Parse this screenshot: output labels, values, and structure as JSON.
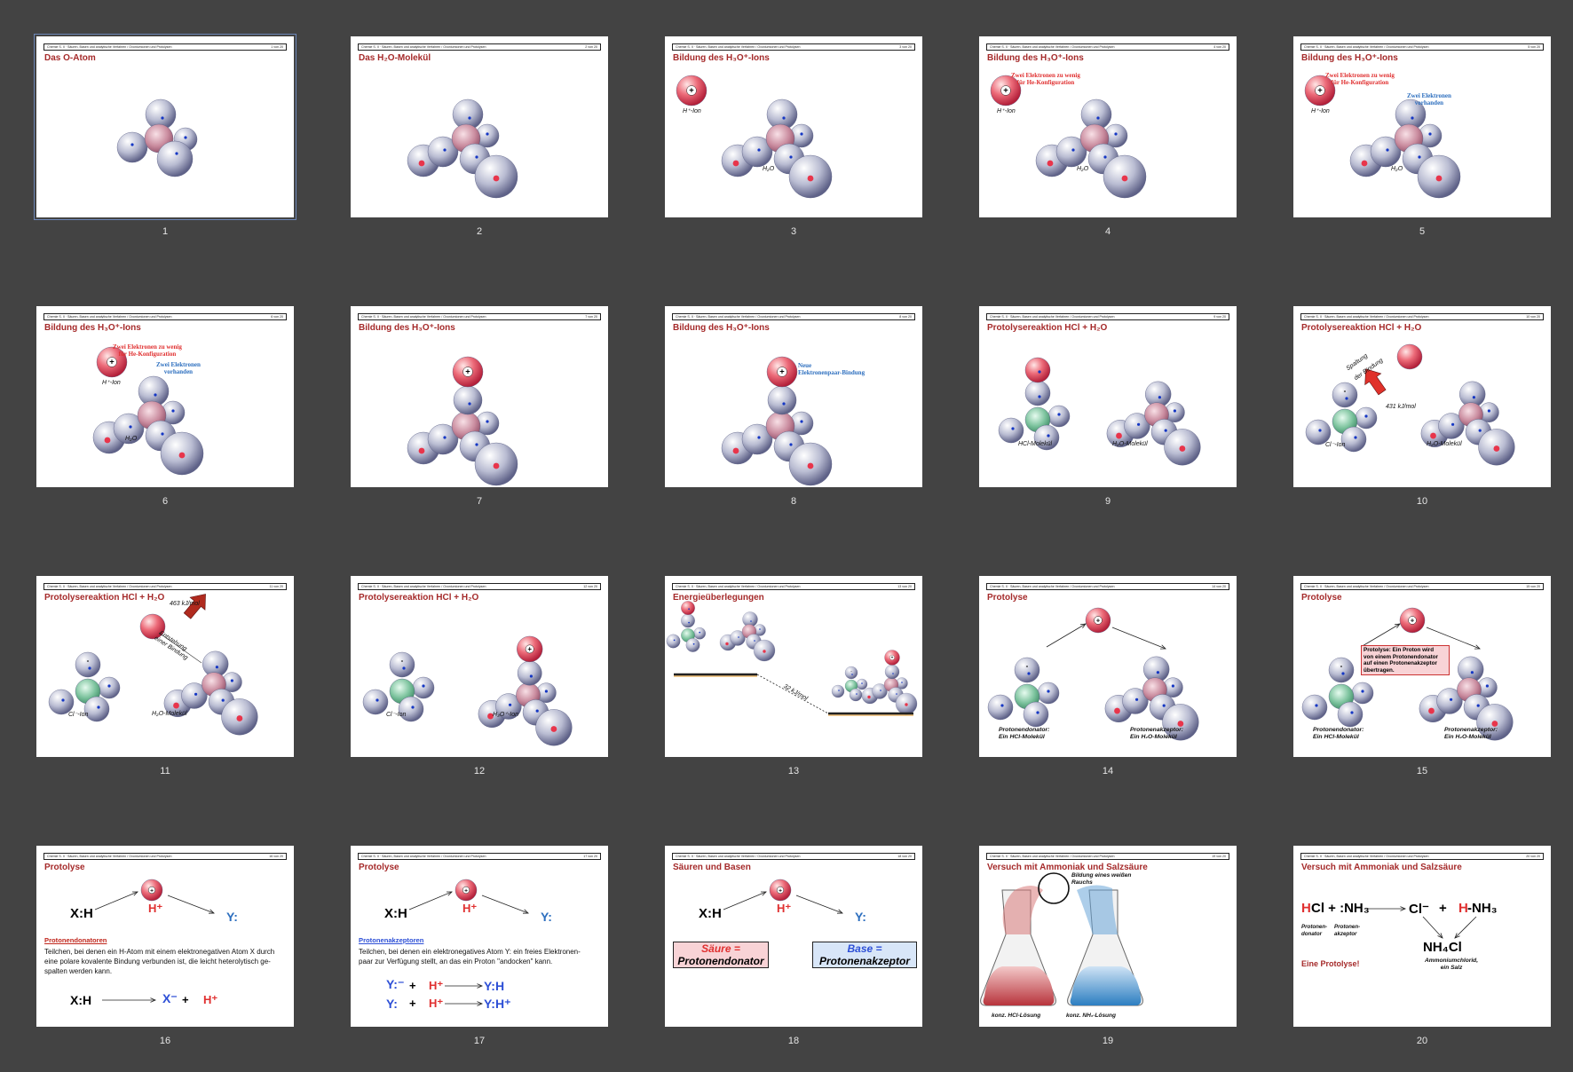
{
  "sorter": {
    "selected_slide": 1,
    "header_text": "Chemie S. II · Säuren, Basen und analytische Verfahren / Oxoniumionen und Protolysen",
    "colors": {
      "background": "#434343",
      "title": "#a52a2a",
      "red": "#e03030",
      "blue": "#2d6fbf"
    }
  },
  "slides": [
    {
      "number": "1",
      "page": "1 von 20",
      "title": "Das O-Atom"
    },
    {
      "number": "2",
      "page": "2 von 20",
      "title": "Das H₂O-Molekül"
    },
    {
      "number": "3",
      "page": "3 von 20",
      "title": "Bildung des H₃O⁺-Ions",
      "labels": [
        "H⁺-Ion",
        "H₂O"
      ]
    },
    {
      "number": "4",
      "page": "4 von 20",
      "title": "Bildung des H₃O⁺-Ions",
      "labels": [
        "Zwei Elektronen zu wenig",
        "für He-Konfiguration",
        "H⁺-Ion",
        "H₂O"
      ]
    },
    {
      "number": "5",
      "page": "5 von 20",
      "title": "Bildung des H₃O⁺-Ions",
      "labels": [
        "Zwei Elektronen zu wenig",
        "für He-Konfiguration",
        "Zwei Elektronen",
        "vorhanden",
        "H⁺-Ion",
        "H₂O"
      ]
    },
    {
      "number": "6",
      "page": "6 von 20",
      "title": "Bildung des H₃O⁺-Ions",
      "labels": [
        "Zwei Elektronen zu wenig",
        "für He-Konfiguration",
        "Zwei Elektronen",
        "vorhanden",
        "H⁺-Ion",
        "H₂O"
      ]
    },
    {
      "number": "7",
      "page": "7 von 20",
      "title": "Bildung des H₃O⁺-Ions"
    },
    {
      "number": "8",
      "page": "8 von 20",
      "title": "Bildung des H₃O⁺-Ions",
      "labels": [
        "Neue",
        "Elektronenpaar-Bindung"
      ]
    },
    {
      "number": "9",
      "page": "9 von 20",
      "title": "Protolysereaktion HCl + H₂O",
      "labels": [
        "HCl-Molekül",
        "H₂O-Molekül"
      ]
    },
    {
      "number": "10",
      "page": "10 von 20",
      "title": "Protolysereaktion HCl + H₂O",
      "labels": [
        "Spaltung",
        "der Bindung",
        "431 kJ/mol",
        "Cl⁻-Ion",
        "H₂O-Molekül"
      ]
    },
    {
      "number": "11",
      "page": "11 von 20",
      "title": "Protolysereaktion HCl + H₂O",
      "labels": [
        "463 kJ/mol",
        "Entstehung",
        "einer Bindung",
        "Cl⁻-Ion",
        "H₂O-Molekül"
      ]
    },
    {
      "number": "12",
      "page": "12 von 20",
      "title": "Protolysereaktion HCl + H₂O",
      "labels": [
        "Cl⁻-Ion",
        "H₃O⁺-Ion"
      ]
    },
    {
      "number": "13",
      "page": "13 von 20",
      "title": "Energieüberlegungen",
      "labels": [
        "32 kJ/mol"
      ]
    },
    {
      "number": "14",
      "page": "14 von 20",
      "title": "Protolyse",
      "labels": [
        "Protonendonator:",
        "Ein HCl-Molekül",
        "Protonenakzeptor:",
        "Ein H₂O-Molekül"
      ]
    },
    {
      "number": "15",
      "page": "15 von 20",
      "title": "Protolyse",
      "labels": [
        "Protolyse: Ein Proton wird",
        "von einem Protonendonator",
        "auf einen Protonenakzeptor",
        "übertragen.",
        "Protonendonator:",
        "Ein HCl-Molekül",
        "Protonenakzeptor:",
        "Ein H₂O-Molekül"
      ]
    },
    {
      "number": "16",
      "page": "16 von 20",
      "title": "Protolyse",
      "labels": [
        "X:H",
        "H⁺",
        "Y:",
        "Protonendonatoren",
        "Teilchen, bei denen ein H-Atom mit einem elektronegativen Atom X durch",
        "eine polare kovalente Bindung verbunden ist, die leicht heterolytisch ge-",
        "spalten werden kann.",
        "X:H",
        "X⁻",
        "+",
        "H⁺"
      ]
    },
    {
      "number": "17",
      "page": "17 von 20",
      "title": "Protolyse",
      "labels": [
        "X:H",
        "H⁺",
        "Y:",
        "Protonenakzeptoren",
        "Teilchen, bei denen ein elektronegatives Atom Y: ein freies Elektronen-",
        "paar zur Verfügung stellt, an das ein Proton \"andocken\" kann.",
        "Y:⁻",
        "+",
        "H⁺",
        "Y:H",
        "Y:",
        "+",
        "H⁺",
        "Y:H⁺"
      ]
    },
    {
      "number": "18",
      "page": "18 von 20",
      "title": "Säuren und Basen",
      "labels": [
        "X:H",
        "H⁺",
        "Y:",
        "Säure =",
        "Protonendonator",
        "Base =",
        "Protonenakzeptor"
      ]
    },
    {
      "number": "19",
      "page": "19 von 20",
      "title": "Versuch mit Ammoniak und Salzsäure",
      "labels": [
        "Bildung eines weißen",
        "Rauchs",
        "konz. HCl-Lösung",
        "konz. NH₃-Lösung"
      ]
    },
    {
      "number": "20",
      "page": "20 von 20",
      "title": "Versuch mit Ammoniak und Salzsäure",
      "labels": [
        "H",
        "Cl + :NH₃",
        "Cl⁻",
        "+",
        "H",
        "-NH₃",
        "Protonen-",
        "donator",
        "Protonen-",
        "akzeptor",
        "NH₄Cl",
        "Ammoniumchlorid,",
        "ein Salz",
        "Eine Protolyse!"
      ]
    }
  ]
}
